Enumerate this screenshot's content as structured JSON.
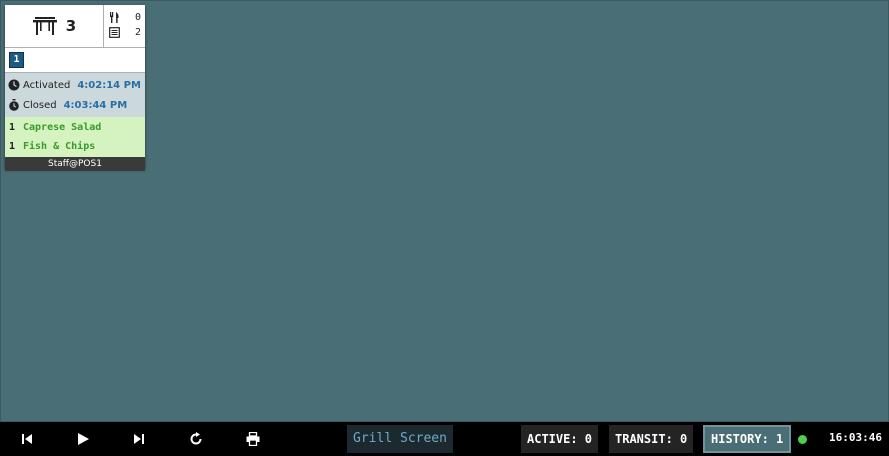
{
  "ticket": {
    "table_number": "3",
    "icons": {
      "table": "table-icon",
      "cutlery": "cutlery-icon",
      "receipt": "receipt-icon",
      "clock": "clock-icon",
      "stopwatch": "stopwatch-icon"
    },
    "cutlery_count": "0",
    "receipt_count": "2",
    "seat_badge": "1",
    "activated_label": "Activated",
    "activated_time": "4:02:14 PM",
    "closed_label": "Closed",
    "closed_time": "4:03:44 PM",
    "items": [
      {
        "qty": "1",
        "name": "Caprese Salad"
      },
      {
        "qty": "1",
        "name": "Fish & Chips"
      }
    ],
    "footer": "Staff@POS1"
  },
  "toolbar": {
    "buttons": [
      "skip-back-icon",
      "play-icon",
      "skip-forward-icon",
      "refresh-icon",
      "print-icon"
    ],
    "screen_name": "Grill Screen",
    "active": "ACTIVE: 0",
    "transit": "TRANSIT: 0",
    "history": "HISTORY: 1",
    "clock": "16:03:46",
    "status_color": "#4ed04e"
  },
  "colors": {
    "background": "#4a6e75",
    "seat_badge": "#1f5a82",
    "time_value": "#2a6ea3",
    "item_text": "#3a9a2a",
    "items_bg": "#d4f3c0",
    "times_bg": "#cbd8dc"
  }
}
